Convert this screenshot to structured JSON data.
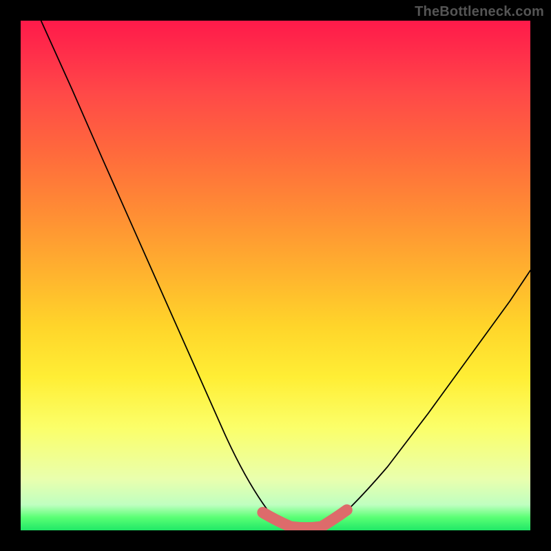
{
  "watermark": {
    "text": "TheBottleneck.com"
  },
  "chart_data": {
    "type": "line",
    "title": "",
    "xlabel": "",
    "ylabel": "",
    "xlim": [
      0,
      1000
    ],
    "ylim": [
      0,
      1000
    ],
    "series": [
      {
        "name": "main-curve",
        "color": "#000000",
        "x": [
          40,
          100,
          160,
          220,
          280,
          340,
          400,
          450,
          500,
          530,
          560,
          590,
          620,
          660,
          720,
          800,
          880,
          960,
          1000
        ],
        "values": [
          1000,
          867,
          730,
          595,
          460,
          325,
          190,
          80,
          20,
          5,
          0,
          5,
          20,
          55,
          125,
          230,
          340,
          450,
          510
        ]
      },
      {
        "name": "highlight-band",
        "color": "#dd6b6b",
        "x": [
          475,
          500,
          530,
          560,
          590,
          615,
          640
        ],
        "values": [
          35,
          20,
          7,
          3,
          7,
          22,
          40
        ]
      }
    ],
    "gradient_stops": [
      {
        "pos": 0.0,
        "color": "#ff1a4a"
      },
      {
        "pos": 0.5,
        "color": "#ffb42e"
      },
      {
        "pos": 0.8,
        "color": "#fbff6a"
      },
      {
        "pos": 0.97,
        "color": "#59ff74"
      },
      {
        "pos": 1.0,
        "color": "#20e867"
      }
    ]
  }
}
